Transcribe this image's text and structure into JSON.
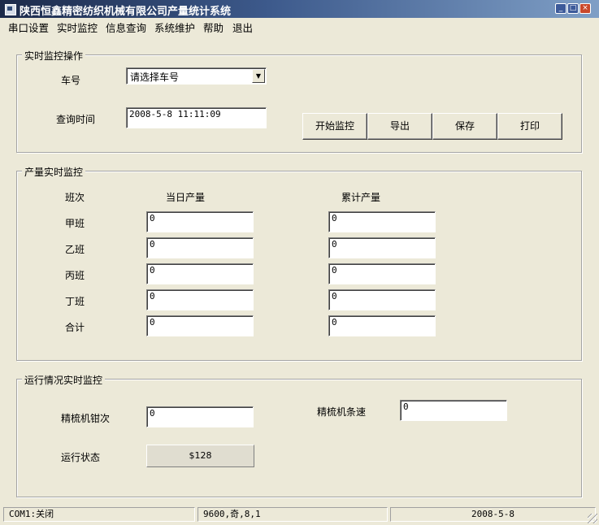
{
  "window": {
    "title": "陕西恒鑫精密纺织机械有限公司产量统计系统",
    "min_glyph": "_",
    "max_glyph": "□",
    "close_glyph": "×"
  },
  "menu": [
    "串口设置",
    "实时监控",
    "信息查询",
    "系统维护",
    "帮助",
    "退出"
  ],
  "monitor_ops": {
    "title": "实时监控操作",
    "car_label": "车号",
    "car_select_value": "请选择车号",
    "time_label": "查询时间",
    "time_value": "2008-5-8 11:11:09",
    "buttons": [
      "开始监控",
      "导出",
      "保存",
      "打印"
    ]
  },
  "production": {
    "title": "产量实时监控",
    "col_shift": "班次",
    "col_daily": "当日产量",
    "col_total": "累计产量",
    "rows": [
      {
        "shift": "甲班",
        "daily": "0",
        "total": "0"
      },
      {
        "shift": "乙班",
        "daily": "0",
        "total": "0"
      },
      {
        "shift": "丙班",
        "daily": "0",
        "total": "0"
      },
      {
        "shift": "丁班",
        "daily": "0",
        "total": "0"
      },
      {
        "shift": "合计",
        "daily": "0",
        "total": "0"
      }
    ]
  },
  "running": {
    "title": "运行情况实时监控",
    "clamp_label": "精梳机钳次",
    "clamp_value": "0",
    "speed_label": "精梳机条速",
    "speed_value": "0",
    "state_label": "运行状态",
    "state_value": "$128"
  },
  "status": {
    "port": "COM1:关闭",
    "settings": "9600,奇,8,1",
    "date": "2008-5-8"
  }
}
